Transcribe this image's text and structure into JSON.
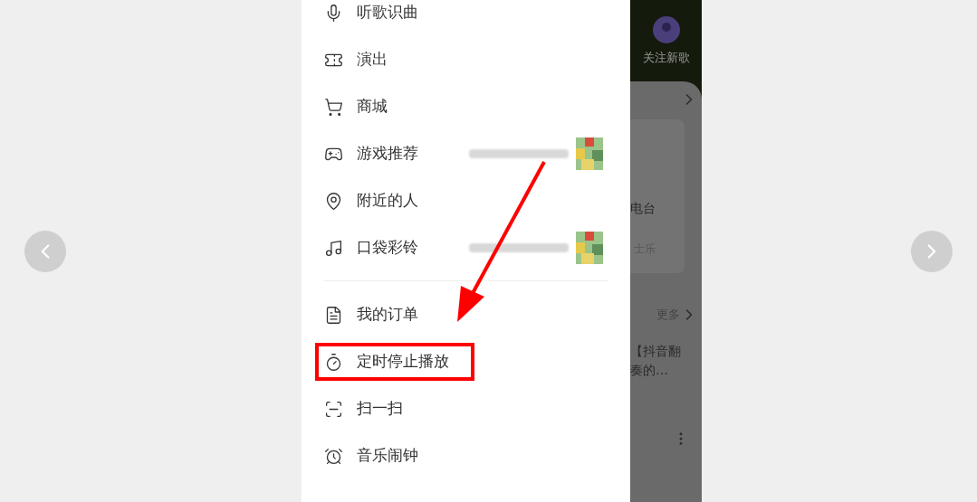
{
  "menu_sections": [
    {
      "items": [
        {
          "label": "听歌识曲",
          "highlighted": false,
          "preview": false
        },
        {
          "label": "演出",
          "highlighted": false,
          "preview": false
        },
        {
          "label": "商城",
          "highlighted": false,
          "preview": false
        },
        {
          "label": "游戏推荐",
          "highlighted": false,
          "preview": true
        },
        {
          "label": "附近的人",
          "highlighted": false,
          "preview": false
        },
        {
          "label": "口袋彩铃",
          "highlighted": false,
          "preview": true
        }
      ]
    },
    {
      "items": [
        {
          "label": "我的订单",
          "highlighted": false,
          "preview": false
        },
        {
          "label": "定时停止播放",
          "highlighted": true,
          "preview": false
        },
        {
          "label": "扫一扫",
          "highlighted": false,
          "preview": false
        },
        {
          "label": "音乐闹钟",
          "highlighted": false,
          "preview": false
        }
      ]
    }
  ],
  "background_app": {
    "follow_label": "关注新歌",
    "card_title": "电台",
    "card_subtitle": "士乐",
    "more_link": "更多",
    "song_line_1": "【抖音翻",
    "song_line_2": "奏的…"
  }
}
